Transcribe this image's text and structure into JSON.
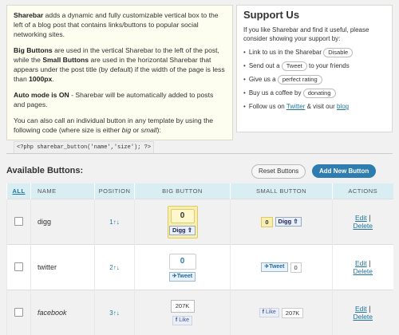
{
  "intro": {
    "p1_b": "Sharebar",
    "p1_rest": " adds a dynamic and fully customizable vertical box to the left of a blog post that contains links/buttons to popular social networking sites.",
    "p2_b1": "Big Buttons",
    "p2_t1": " are used in the vertical Sharebar to the left of the post, while the ",
    "p2_b2": "Small Buttons",
    "p2_t2": " are used in the horizontal Sharebar that appears under the post title (by default) if the width of the page is less than ",
    "p2_b3": "1000px",
    "p2_t3": ".",
    "p3_b": "Auto mode is ON",
    "p3_rest": " - Sharebar will be automatically added to posts and pages.",
    "p4_t1": "You can also call an individual button in any template by using the following code (where size is either ",
    "p4_i1": "big",
    "p4_t2": " or ",
    "p4_i2": "small",
    "p4_t3": "):",
    "code": "<?php sharebar_button('name','size'); ?>"
  },
  "support": {
    "title": "Support Us",
    "text": "If you like Sharebar and find it useful, please consider showing your support by:",
    "item1_text": "Link to us in the Sharebar",
    "item1_btn": "Disable",
    "item2_pre": "Send out a",
    "item2_btn": "Tweet",
    "item2_post": "to your friends",
    "item3_pre": "Give us a",
    "item3_btn": "perfect rating",
    "item4_pre": "Buy us a coffee by",
    "item4_btn": "donating",
    "item5_pre": "Follow us on",
    "item5_link1": "Twitter",
    "item5_mid": "& visit our",
    "item5_link2": "blog"
  },
  "buttons_section": {
    "title": "Available Buttons:",
    "reset_label": "Reset Buttons",
    "add_label": "Add New Button"
  },
  "table": {
    "headers": {
      "all": "ALL",
      "name": "NAME",
      "position": "POSITION",
      "big": "BIG BUTTON",
      "small": "SMALL BUTTON",
      "actions": "ACTIONS"
    },
    "rows": [
      {
        "name": "digg",
        "position": "1",
        "big_count": "0",
        "big_label": "Digg",
        "small_count": "0",
        "small_label": "Digg",
        "edit": "Edit",
        "delete": "Delete"
      },
      {
        "name": "twitter",
        "position": "2",
        "big_count": "0",
        "big_label": "Tweet",
        "small_count": "0",
        "small_label": "Tweet",
        "edit": "Edit",
        "delete": "Delete"
      },
      {
        "name": "facebook",
        "position": "3",
        "big_count": "207K",
        "big_label": "Like",
        "small_count": "207K",
        "small_label": "Like",
        "edit": "Edit",
        "delete": "Delete"
      }
    ],
    "pos_arrows": "↑↓",
    "separator": "|"
  },
  "colors": {
    "accent": "#21759b",
    "add_button": "#2e7db0",
    "header_bg": "#d8eef3",
    "digg_yellow": "#f7eeb4"
  }
}
